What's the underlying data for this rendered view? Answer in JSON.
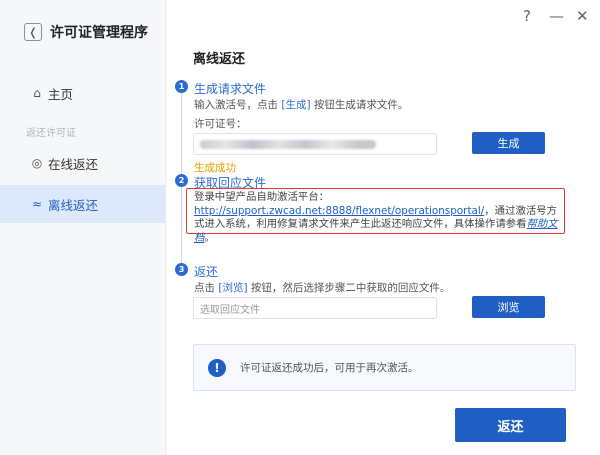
{
  "app": {
    "title": "许可证管理程序",
    "back_icon": "chevron-left-icon"
  },
  "window_controls": {
    "help": "?",
    "minimize": "—",
    "close": "✕"
  },
  "sidebar": {
    "home_label": "主页",
    "group_label": "返还许可证",
    "online_label": "在线返还",
    "offline_label": "离线返还",
    "active_item": "离线返还"
  },
  "main": {
    "title": "离线返还",
    "step1": {
      "number": "1",
      "title": "生成请求文件",
      "desc_prefix": "输入激活号，点击 ",
      "desc_highlight": "[生成]",
      "desc_suffix": " 按钮生成请求文件。",
      "license_label": "许可证号：",
      "generate_button": "生成",
      "status": "生成成功"
    },
    "step2": {
      "number": "2",
      "title": "获取回应文件",
      "text_prefix": "登录中望产品自助激活平台：",
      "link_text": "http://support.zwcad.net:8888/flexnet/operationsportal/",
      "text_middle": "，通过激活号方式进入系统，利用修复请求文件来产生此返还响应文件，具体操作请参看",
      "help_link": "帮助文档",
      "text_end": "。"
    },
    "step3": {
      "number": "3",
      "title": "返还",
      "desc_prefix": "点击 ",
      "desc_highlight": "[浏览]",
      "desc_suffix": " 按钮，然后选择步骤二中获取的回应文件。",
      "file_placeholder": "选取回应文件",
      "browse_button": "浏览"
    },
    "notice": {
      "icon": "!",
      "text": "许可证返还成功后，可用于再次激活。"
    },
    "return_button": "返还"
  },
  "colors": {
    "accent": "#1f5fc4",
    "success": "#e0a200",
    "highlight_border": "#e53a3a",
    "sidebar_active": "#dde9fb"
  }
}
